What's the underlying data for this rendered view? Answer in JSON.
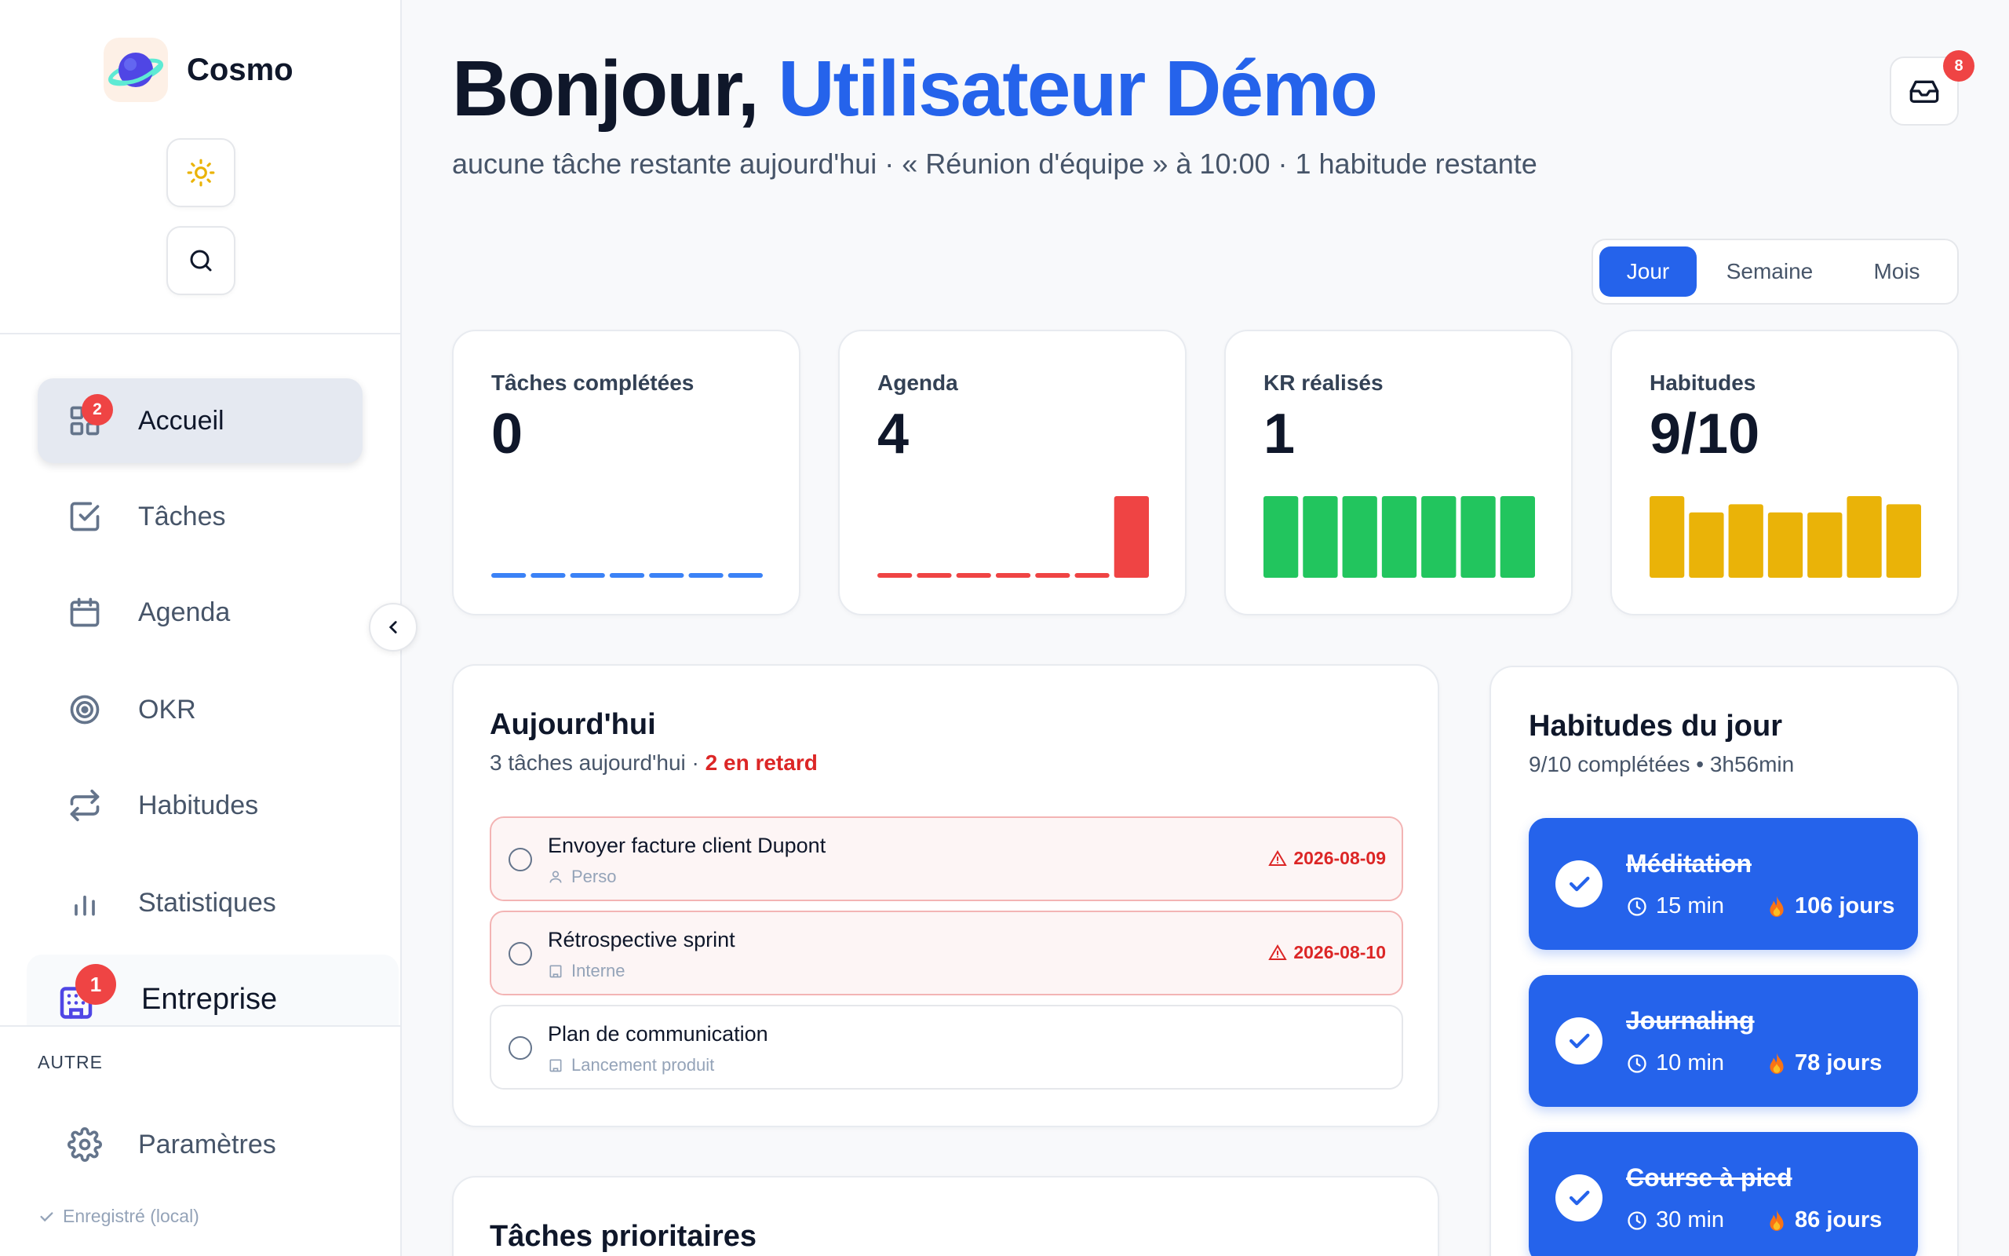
{
  "brand": {
    "name": "Cosmo"
  },
  "sidebar": {
    "items": [
      {
        "label": "Accueil",
        "badge": "2"
      },
      {
        "label": "Tâches"
      },
      {
        "label": "Agenda"
      },
      {
        "label": "OKR"
      },
      {
        "label": "Habitudes"
      },
      {
        "label": "Statistiques"
      },
      {
        "label": "Entreprise",
        "badge": "1"
      }
    ],
    "other_section": "AUTRE",
    "settings_label": "Paramètres",
    "saved_status": "Enregistré (local)"
  },
  "header": {
    "greeting": "Bonjour, ",
    "user_name": "Utilisateur Démo",
    "subtitle": "aucune tâche restante aujourd'hui · « Réunion d'équipe » à 10:00 · 1 habitude restante",
    "inbox_badge": "8"
  },
  "period_tabs": [
    "Jour",
    "Semaine",
    "Mois"
  ],
  "period_selected": "Jour",
  "stats": [
    {
      "label": "Tâches complétées",
      "value": "0",
      "color": "#3b82f6",
      "bars": [
        0,
        0,
        0,
        0,
        0,
        0,
        0
      ]
    },
    {
      "label": "Agenda",
      "value": "4",
      "color": "#ef4444",
      "bars": [
        0,
        0,
        0,
        0,
        0,
        0,
        4
      ]
    },
    {
      "label": "KR réalisés",
      "value": "1",
      "color": "#22c55e",
      "bars": [
        1,
        1,
        1,
        1,
        1,
        1,
        1
      ]
    },
    {
      "label": "Habitudes",
      "value": "9/10",
      "color": "#eab308",
      "bars": [
        10,
        8,
        9,
        8,
        8,
        10,
        9
      ]
    }
  ],
  "today": {
    "title": "Aujourd'hui",
    "summary": "3 tâches aujourd'hui",
    "separator": " · ",
    "overdue": "2 en retard",
    "tasks": [
      {
        "name": "Envoyer facture client Dupont",
        "project": "Perso",
        "due": "2026-08-09"
      },
      {
        "name": "Rétrospective sprint",
        "project": "Interne",
        "due": "2026-08-10"
      },
      {
        "name": "Plan de communication",
        "project": "Lancement produit",
        "due": ""
      }
    ]
  },
  "priority": {
    "title": "Tâches prioritaires"
  },
  "habits": {
    "title": "Habitudes du jour",
    "summary": "9/10 complétées • 3h56min",
    "items": [
      {
        "name": "Méditation",
        "duration": "15 min",
        "streak": "106 jours"
      },
      {
        "name": "Journaling",
        "duration": "10 min",
        "streak": "78 jours"
      },
      {
        "name": "Course à pied",
        "duration": "30 min",
        "streak": "86 jours"
      }
    ]
  }
}
